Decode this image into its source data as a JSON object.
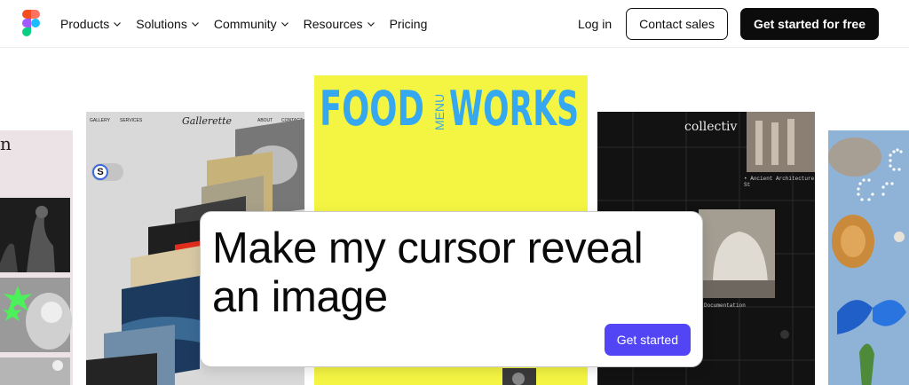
{
  "nav": {
    "menu": [
      {
        "label": "Products",
        "has_chevron": true
      },
      {
        "label": "Solutions",
        "has_chevron": true
      },
      {
        "label": "Community",
        "has_chevron": true
      },
      {
        "label": "Resources",
        "has_chevron": true
      },
      {
        "label": "Pricing",
        "has_chevron": false
      }
    ],
    "login": "Log in",
    "contact": "Contact sales",
    "cta": "Get started for free"
  },
  "cards": {
    "gallery": {
      "nav_left1": "GALLERY",
      "nav_left2": "SERVICES",
      "title": "Gallerette",
      "nav_right1": "ABOUT",
      "nav_right2": "CONTACT",
      "toggle_letter": "S"
    },
    "food": {
      "title_left": "FOOD",
      "menu": "MENU",
      "title_right": "WORKS"
    },
    "collectiv": {
      "title": "collectiv",
      "caption1": "• Ancient Architecture St",
      "caption2": "Documentation"
    },
    "left": {
      "letter": "n"
    }
  },
  "prompt": {
    "text": "Make my cursor reveal an image",
    "button": "Get started"
  },
  "colors": {
    "accent": "#5245f5",
    "food_bg": "#f4f542",
    "food_text": "#35a8ef",
    "figma": [
      "#f24e1e",
      "#ff7262",
      "#a259ff",
      "#1abcfe",
      "#0acf83"
    ]
  }
}
